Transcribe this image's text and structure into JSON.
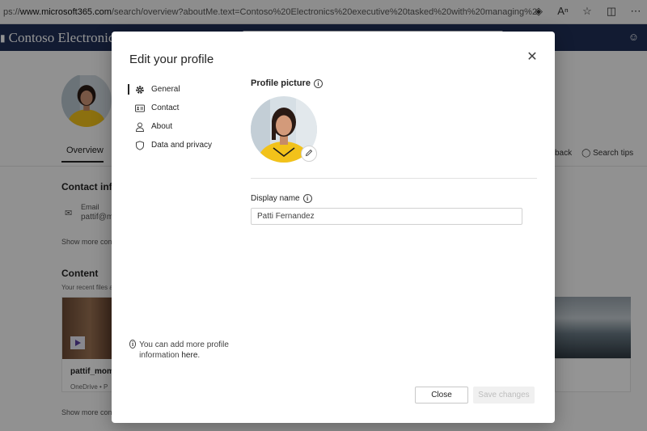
{
  "browser": {
    "url_prefix": "ps://",
    "url_host": "www.microsoft365.com",
    "url_rest": "/search/overview?aboutMe.text=Contoso%20Electronics%20executive%20tasked%20with%20managing%20global%20commun..."
  },
  "app": {
    "title": "Contoso Electronics"
  },
  "background_page": {
    "tab_overview": "Overview",
    "contact_heading": "Contact info",
    "email_label": "Email",
    "email_value": "pattif@m",
    "show_more_contact": "Show more cont",
    "content_heading": "Content",
    "recent_files": "Your recent files a",
    "card_name": "pattif_mom",
    "card_sub": "OneDrive • P",
    "show_more_content": "Show more cont",
    "feedback_link": "back",
    "search_tips_link": "Search tips"
  },
  "modal": {
    "title": "Edit your profile",
    "nav": [
      {
        "label": "General",
        "icon": "gear-icon"
      },
      {
        "label": "Contact",
        "icon": "contact-card-icon"
      },
      {
        "label": "About",
        "icon": "person-icon"
      },
      {
        "label": "Data and privacy",
        "icon": "shield-icon"
      }
    ],
    "note_text": "You can add more profile information ",
    "note_link": "here",
    "note_end": ".",
    "profile_picture_label": "Profile picture",
    "display_name_label": "Display name",
    "display_name_value": "Patti Fernandez",
    "close_button": "Close",
    "save_button": "Save changes"
  },
  "colors": {
    "app_header": "#1f2f57",
    "blouse_yellow": "#f2c21a"
  }
}
